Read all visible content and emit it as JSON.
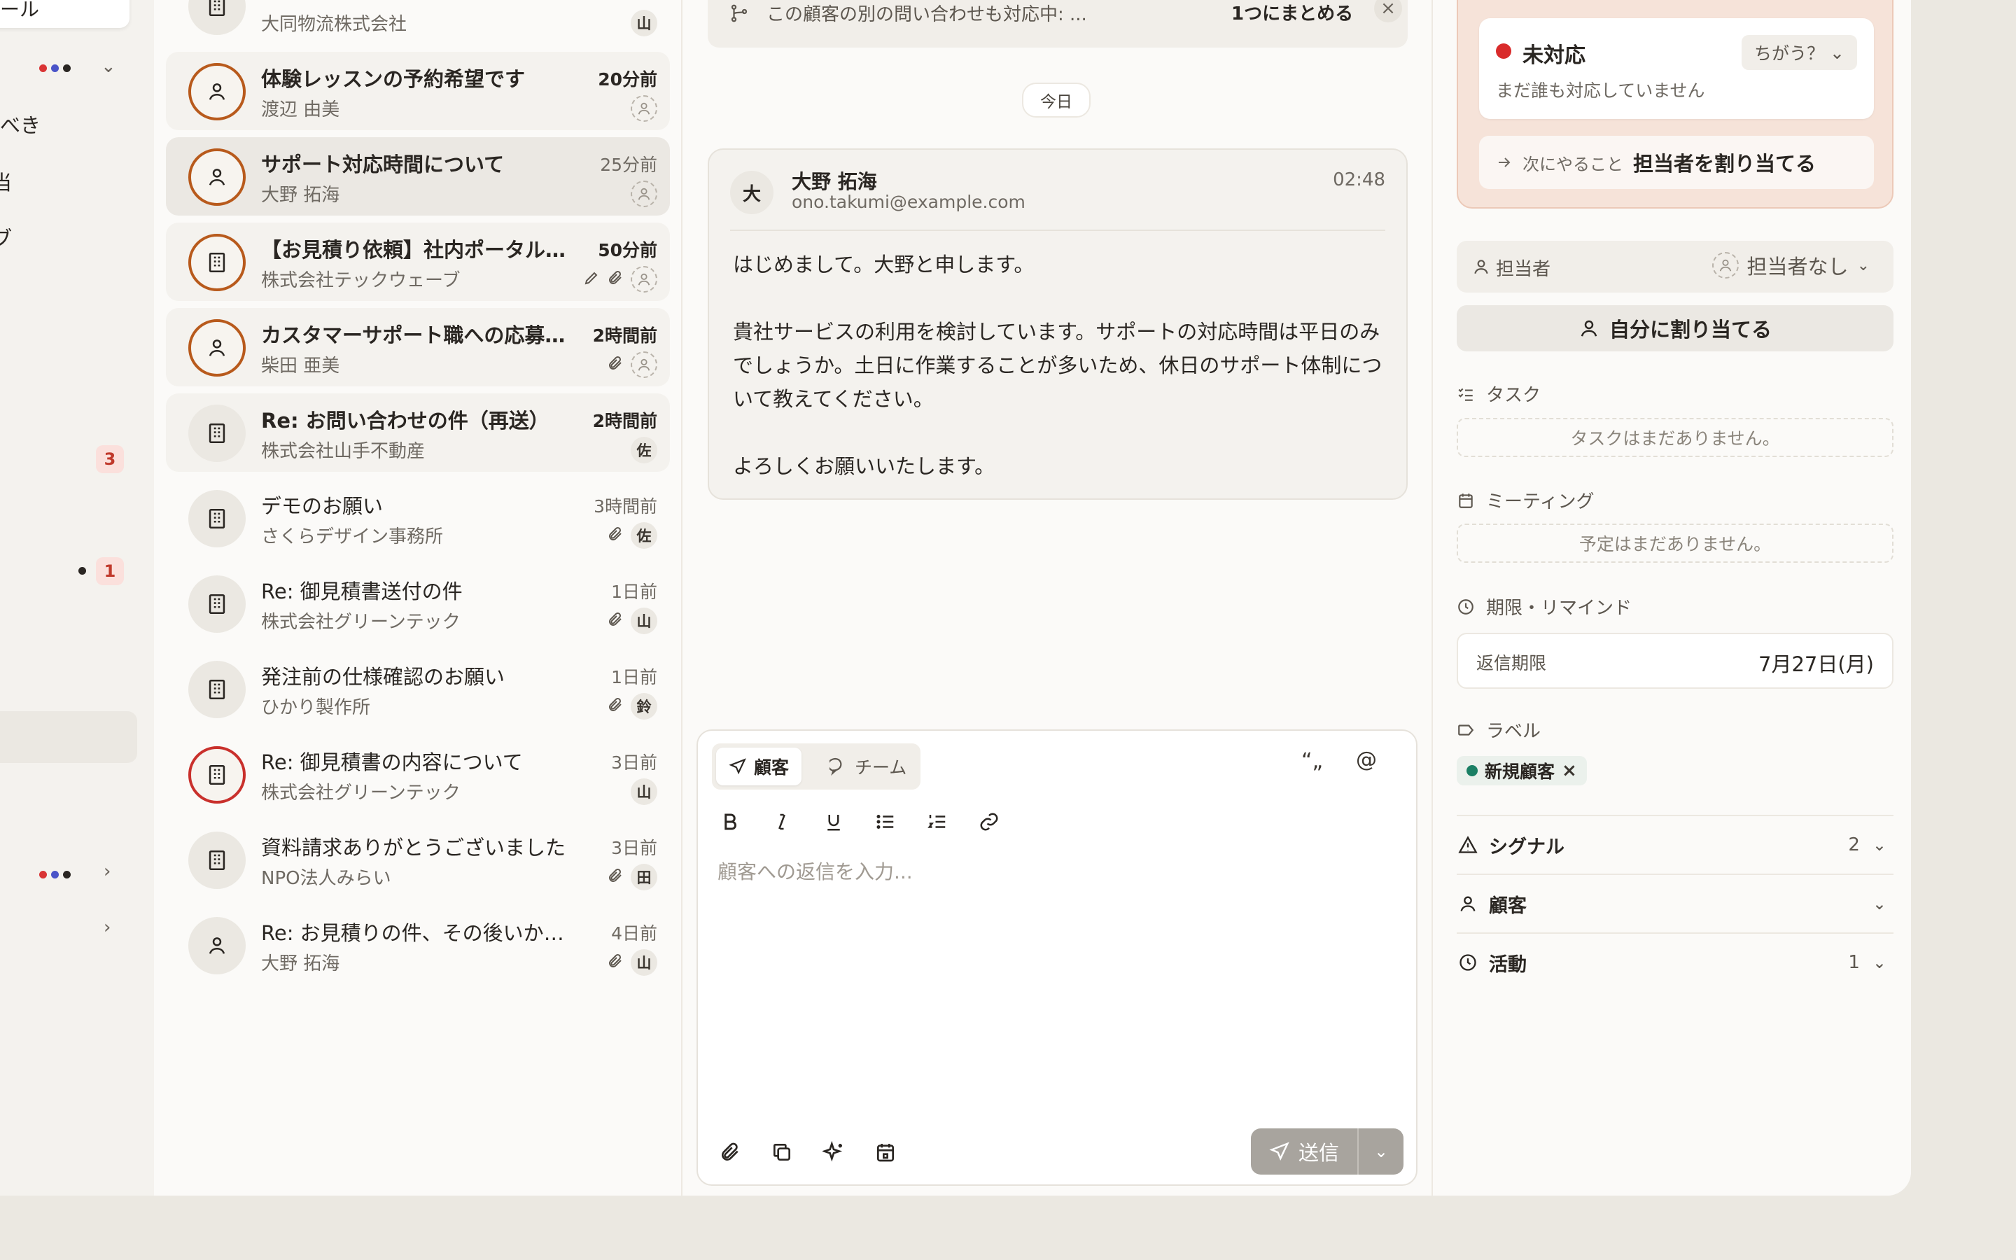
{
  "sidebar": {
    "top_fragment": "ール",
    "fragment_1": "べき",
    "fragment_2": "当",
    "fragment_3": "ブ",
    "badge_1": "3",
    "badge_2": "1",
    "dots_colors": [
      "#d93434",
      "#4a54c8",
      "#2a2622"
    ]
  },
  "inbox": {
    "rows": [
      {
        "subject": "体験レッスンの予約希望です",
        "sender": "渡辺 由美",
        "time": "20分前",
        "state": "unread",
        "avatar": "person",
        "ring": "orange",
        "assignee": ""
      },
      {
        "subject": "サポート対応時間について",
        "sender": "大野 拓海",
        "time": "25分前",
        "state": "active",
        "avatar": "person",
        "ring": "orange",
        "assignee": ""
      },
      {
        "subject": "【お見積り依頼】社内ポータル構築について",
        "sender": "株式会社テックウェーブ",
        "time": "50分前",
        "state": "unread",
        "avatar": "building",
        "ring": "orange",
        "assignee": ""
      },
      {
        "subject": "カスタマーサポート職への応募（柴田 亜美）",
        "sender": "柴田 亜美",
        "time": "2時間前",
        "state": "unread",
        "avatar": "person",
        "ring": "orange",
        "assignee": ""
      },
      {
        "subject": "Re: お問い合わせの件（再送）",
        "sender": "株式会社山手不動産",
        "time": "2時間前",
        "state": "unread",
        "avatar": "building",
        "ring": "",
        "assignee": "佐"
      },
      {
        "subject": "デモのお願い",
        "sender": "さくらデザイン事務所",
        "time": "3時間前",
        "state": "read",
        "avatar": "building",
        "ring": "",
        "assignee": "佐"
      },
      {
        "subject": "Re: 御見積書送付の件",
        "sender": "株式会社グリーンテック",
        "time": "1日前",
        "state": "read",
        "avatar": "building",
        "ring": "",
        "assignee": "山"
      },
      {
        "subject": "発注前の仕様確認のお願い",
        "sender": "ひかり製作所",
        "time": "1日前",
        "state": "read",
        "avatar": "building",
        "ring": "",
        "assignee": "鈴"
      },
      {
        "subject": "Re: 御見積書の内容について",
        "sender": "株式会社グリーンテック",
        "time": "3日前",
        "state": "read",
        "avatar": "building",
        "ring": "red",
        "assignee": "山"
      },
      {
        "subject": "資料請求ありがとうございました",
        "sender": "NPO法人みらい",
        "time": "3日前",
        "state": "read",
        "avatar": "building",
        "ring": "",
        "assignee": "田"
      },
      {
        "subject": "Re: お見積りの件、その後いかがでしょうか",
        "sender": "大野 拓海",
        "time": "4日前",
        "state": "read",
        "avatar": "person",
        "ring": "",
        "assignee": "山"
      }
    ],
    "partial_top": {
      "sender": "大同物流株式会社",
      "assignee": "山"
    }
  },
  "conversation": {
    "merge_text": "この顧客の別の問い合わせも対応中: ...",
    "merge_button": "1つにまとめる",
    "close": "×",
    "date_divider": "今日",
    "message": {
      "avatar_initial": "大",
      "from_name": "大野 拓海",
      "from_email": "ono.takumi@example.com",
      "time": "02:48",
      "body": "はじめまして。大野と申します。\n\n貴社サービスの利用を検討しています。サポートの対応時間は平日のみでしょうか。土日に作業することが多いため、休日のサポート体制について教えてください。\n\nよろしくお願いいたします。"
    },
    "composer": {
      "tab_customer": "顧客",
      "tab_team": "チーム",
      "quote": "“„",
      "mention": "@",
      "placeholder": "顧客への返信を入力...",
      "send": "送信"
    }
  },
  "details": {
    "status": {
      "title": "未対応",
      "subtitle": "まだ誰も対応していません",
      "change": "ちがう？"
    },
    "next_action": {
      "label": "次にやること",
      "value": "担当者を割り当てる"
    },
    "assignee": {
      "label": "担当者",
      "value": "担当者なし"
    },
    "assign_self": "自分に割り当てる",
    "tasks": {
      "label": "タスク",
      "empty": "タスクはまだありません。"
    },
    "meetings": {
      "label": "ミーティング",
      "empty": "予定はまだありません。"
    },
    "deadline": {
      "label": "期限・リマインド",
      "field": "返信期限",
      "value": "7月27日(月)"
    },
    "labels": {
      "label": "ラベル",
      "tag": "新規顧客",
      "tag_color": "#1a7f64"
    },
    "signals": {
      "label": "シグナル",
      "count": "2"
    },
    "customer": {
      "label": "顧客"
    },
    "activity": {
      "label": "活動",
      "count": "1"
    }
  }
}
